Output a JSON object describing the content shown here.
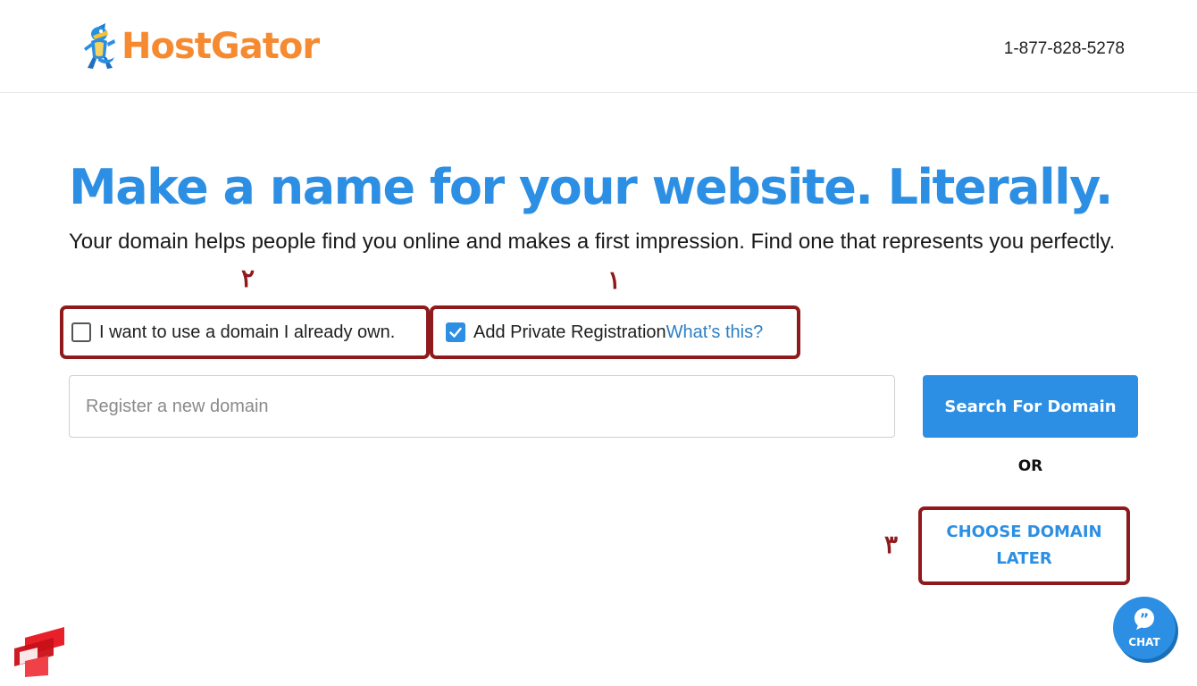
{
  "header": {
    "brand": "HostGator",
    "phone": "1-877-828-5278"
  },
  "hero": {
    "headline": "Make a name for your website. Literally.",
    "subtext": "Your domain helps people find you online and makes a first impression. Find one that represents you perfectly."
  },
  "annotations": {
    "marker_1": "۱",
    "marker_2": "۲",
    "marker_3": "۳"
  },
  "options": {
    "own_domain": {
      "label": "I want to use a domain I already own.",
      "checked": false
    },
    "private_registration": {
      "label": "Add Private Registration",
      "link": "What’s this?",
      "checked": true
    }
  },
  "search": {
    "placeholder": "Register a new domain",
    "value": "",
    "button_label": "Search For Domain"
  },
  "or_text": "OR",
  "choose_later": {
    "line1": "CHOOSE DOMAIN",
    "line2": "LATER"
  },
  "chat": {
    "label": "CHAT"
  },
  "colors": {
    "brand_orange": "#f58a31",
    "accent_blue": "#2d8fe3",
    "annotation_red": "#8f1a1c"
  }
}
